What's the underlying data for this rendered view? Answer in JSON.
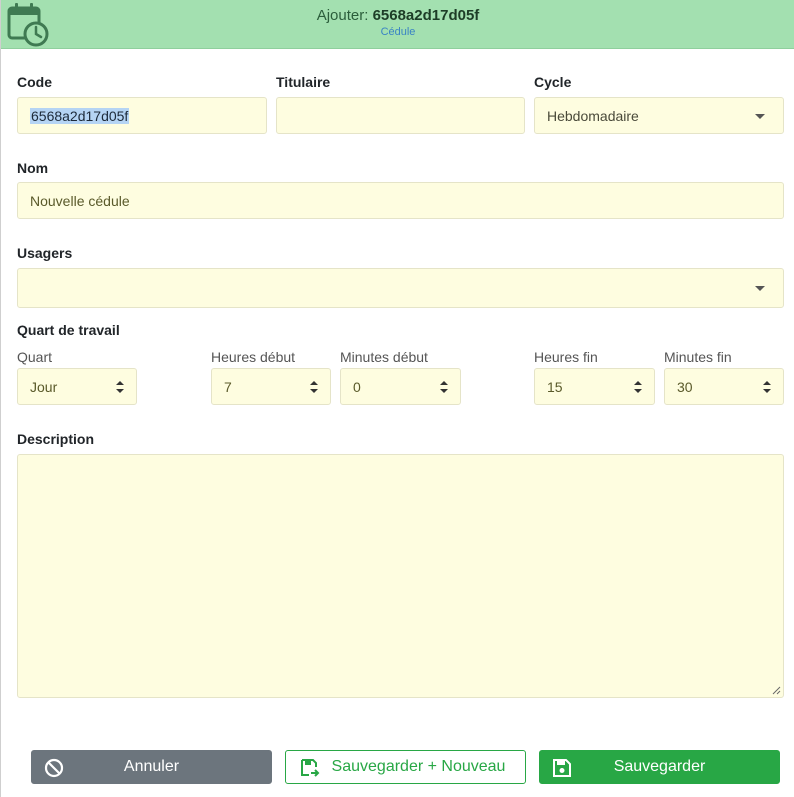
{
  "header": {
    "prefix": "Ajouter: ",
    "code": "6568a2d17d05f",
    "subtitle": "Cédule",
    "icon": "calendar-clock-icon"
  },
  "form": {
    "code": {
      "label": "Code",
      "value": "6568a2d17d05f"
    },
    "titulaire": {
      "label": "Titulaire",
      "value": ""
    },
    "cycle": {
      "label": "Cycle",
      "value": "Hebdomadaire"
    },
    "nom": {
      "label": "Nom",
      "value": "Nouvelle cédule"
    },
    "usagers": {
      "label": "Usagers",
      "value": ""
    },
    "quart_section": {
      "label": "Quart de travail",
      "quart": {
        "label": "Quart",
        "value": "Jour"
      },
      "heures_debut": {
        "label": "Heures début",
        "value": "7"
      },
      "minutes_debut": {
        "label": "Minutes début",
        "value": "0"
      },
      "heures_fin": {
        "label": "Heures fin",
        "value": "15"
      },
      "minutes_fin": {
        "label": "Minutes fin",
        "value": "30"
      }
    },
    "description": {
      "label": "Description",
      "value": ""
    }
  },
  "buttons": {
    "cancel": "Annuler",
    "save_new": "Sauvegarder + Nouveau",
    "save": "Sauvegarder"
  },
  "colors": {
    "header_bg": "#a3e0b0",
    "field_bg": "#fefde0",
    "cancel": "#6c757d",
    "save": "#28a745"
  }
}
